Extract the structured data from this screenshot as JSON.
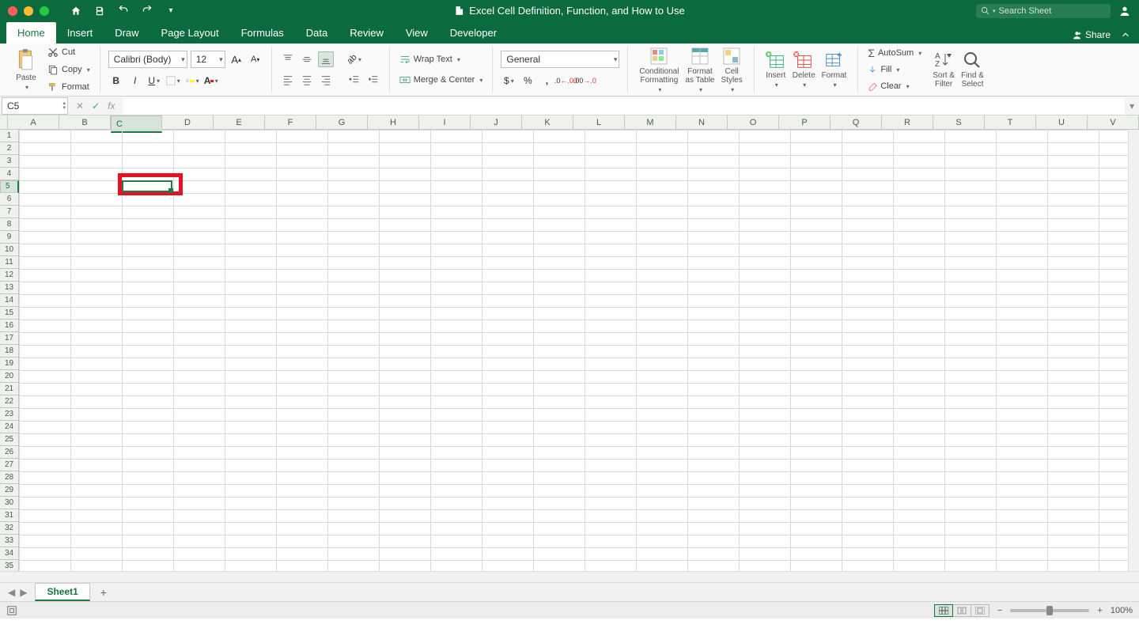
{
  "titlebar": {
    "doc_title": "Excel Cell Definition, Function, and How to Use",
    "search_placeholder": "Search Sheet"
  },
  "tabs": {
    "items": [
      "Home",
      "Insert",
      "Draw",
      "Page Layout",
      "Formulas",
      "Data",
      "Review",
      "View",
      "Developer"
    ],
    "active_index": 0,
    "share_label": "Share"
  },
  "ribbon": {
    "paste_label": "Paste",
    "cut_label": "Cut",
    "copy_label": "Copy",
    "format_painter_label": "Format",
    "font_name": "Calibri (Body)",
    "font_size": "12",
    "wrap_label": "Wrap Text",
    "merge_label": "Merge & Center",
    "number_format": "General",
    "cond_fmt_label": "Conditional\nFormatting",
    "fmt_table_label": "Format\nas Table",
    "cell_styles_label": "Cell\nStyles",
    "insert_label": "Insert",
    "delete_label": "Delete",
    "format_label": "Format",
    "autosum_label": "AutoSum",
    "fill_label": "Fill",
    "clear_label": "Clear",
    "sort_filter_label": "Sort &\nFilter",
    "find_select_label": "Find &\nSelect"
  },
  "formula_bar": {
    "name_box_value": "C5",
    "fx_label": "fx"
  },
  "grid": {
    "columns": [
      "A",
      "B",
      "C",
      "D",
      "E",
      "F",
      "G",
      "H",
      "I",
      "J",
      "K",
      "L",
      "M",
      "N",
      "O",
      "P",
      "Q",
      "R",
      "S",
      "T",
      "U",
      "V"
    ],
    "row_count": 36,
    "selected_cell": {
      "col": "C",
      "row": 5,
      "col_index": 2,
      "row_index": 4
    }
  },
  "sheet_tabs": {
    "active_sheet": "Sheet1"
  },
  "statusbar": {
    "zoom_label": "100%"
  }
}
